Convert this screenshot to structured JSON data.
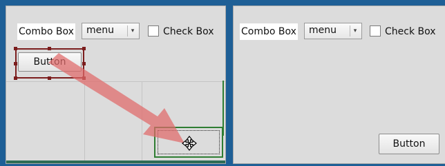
{
  "left_panel": {
    "combo_label": "Combo Box",
    "combo_value": "menu",
    "checkbox_label": "Check Box",
    "button_label": "Button"
  },
  "right_panel": {
    "combo_label": "Combo Box",
    "combo_value": "menu",
    "checkbox_label": "Check Box",
    "button_label": "Button"
  },
  "icons": {
    "combo_arrow": "chevron-down-icon",
    "drag_cursor": "move-cursor-icon",
    "drag_arrow": "drag-arrow-icon"
  },
  "colors": {
    "frame": "#1e5f96",
    "selection": "#7b1d1d",
    "drop_target": "#2e7d32",
    "drag_arrow": "#e06a6a"
  }
}
